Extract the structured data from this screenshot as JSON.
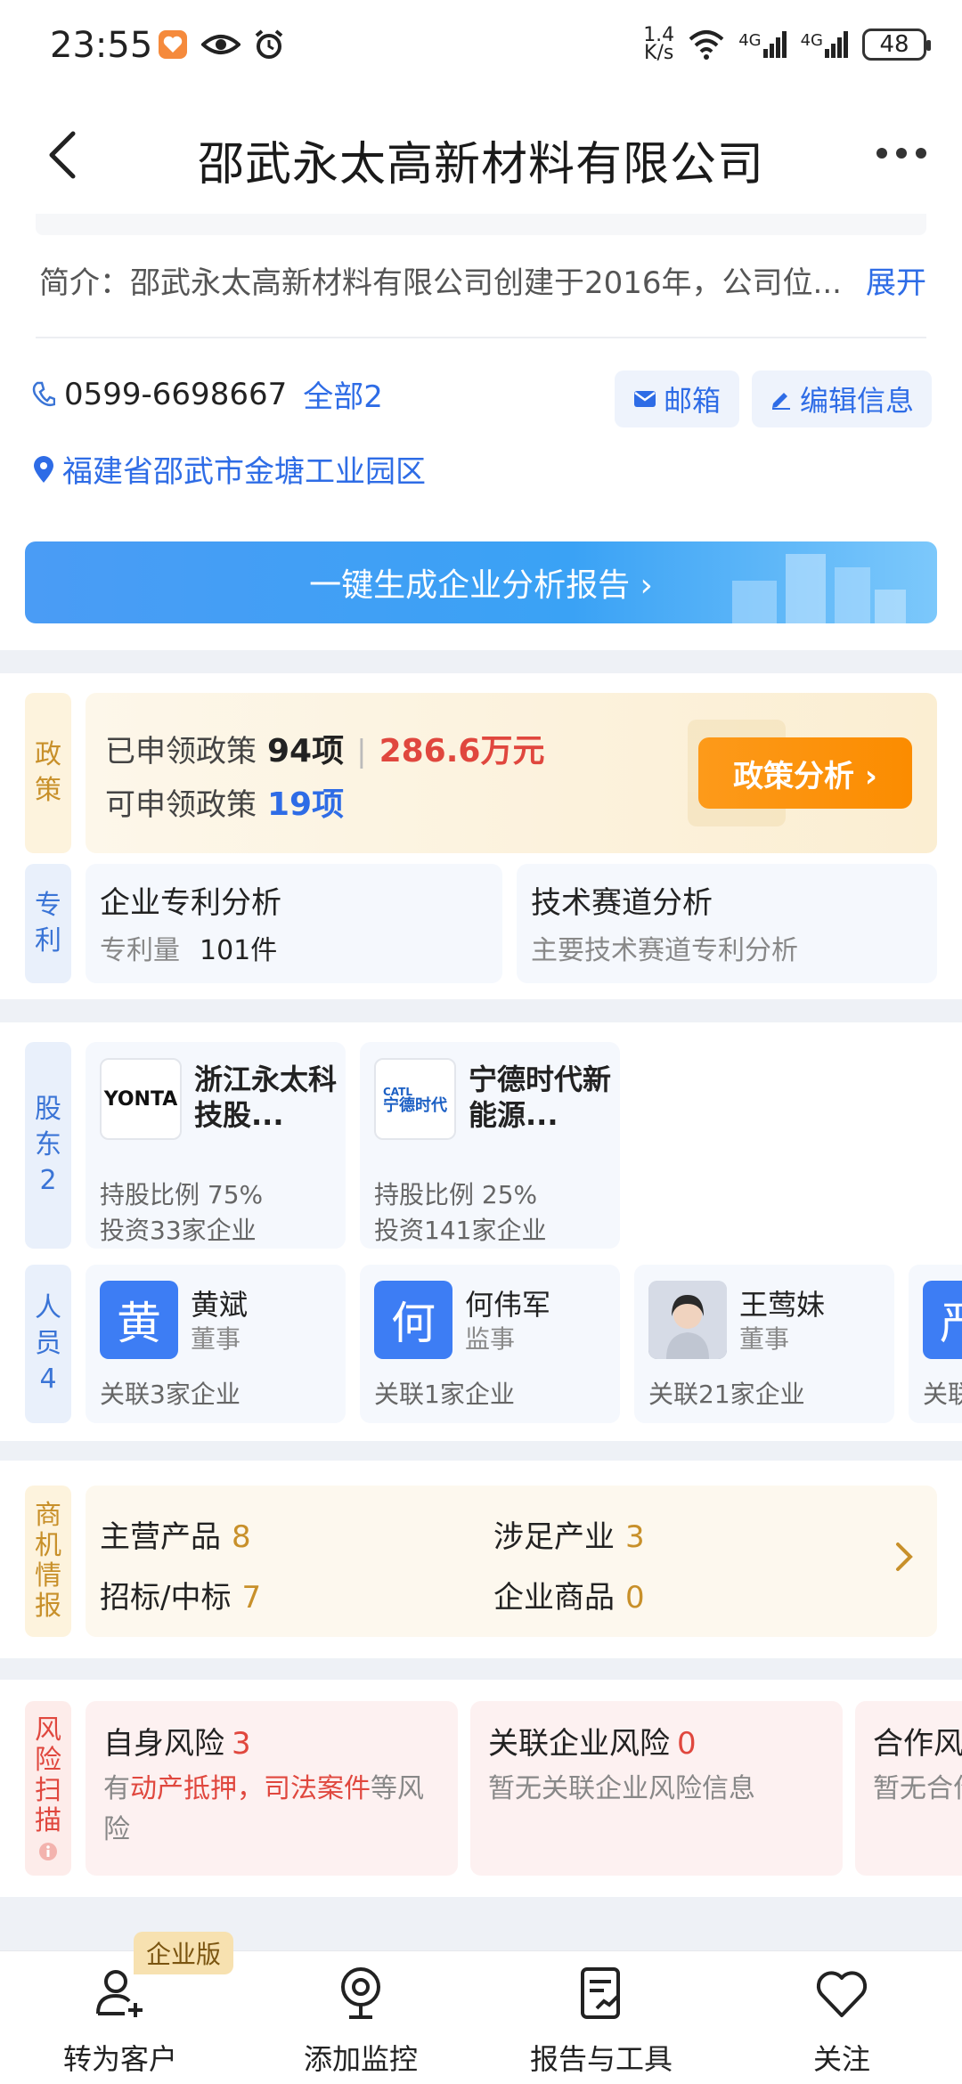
{
  "status": {
    "time": "23:55",
    "net_speed_value": "1.4",
    "net_speed_unit": "K/s",
    "signal1": "4G",
    "signal2": "4G",
    "battery": "48"
  },
  "nav": {
    "title": "邵武永太高新材料有限公司"
  },
  "intro": {
    "label": "简介：",
    "text": "邵武永太高新材料有限公司创建于2016年，公司位...",
    "expand": "展开"
  },
  "contact": {
    "phone": "0599-6698667",
    "all": "全部2",
    "mail": "邮箱",
    "edit": "编辑信息",
    "address": "福建省邵武市金塘工业园区"
  },
  "report_button": "一键生成企业分析报告 ›",
  "policy": {
    "tag": [
      "政",
      "策"
    ],
    "applied_label": "已申领政策",
    "applied_count": "94项",
    "amount": "286.6万元",
    "available_label": "可申领政策",
    "available_count": "19项",
    "button": "政策分析 ›"
  },
  "patent": {
    "tag": [
      "专",
      "利"
    ],
    "left_title": "企业专利分析",
    "left_sub_label": "专利量",
    "left_sub_value": "101件",
    "right_title": "技术赛道分析",
    "right_sub": "主要技术赛道专利分析"
  },
  "shareholders": {
    "tag": [
      "股",
      "东",
      "2"
    ],
    "items": [
      {
        "logo": "YONTA",
        "name": "浙江永太科技股...",
        "ratio": "持股比例 75%",
        "invest": "投资33家企业"
      },
      {
        "logo": "宁德时代",
        "logo_sup": "CATL",
        "name": "宁德时代新能源...",
        "ratio": "持股比例 25%",
        "invest": "投资141家企业"
      }
    ]
  },
  "staff": {
    "tag": [
      "人",
      "员",
      "4"
    ],
    "items": [
      {
        "avatar": "黄",
        "name": "黄斌",
        "role": "董事",
        "rel": "关联3家企业"
      },
      {
        "avatar": "何",
        "name": "何伟军",
        "role": "监事",
        "rel": "关联1家企业"
      },
      {
        "avatar": "",
        "name": "王莺妹",
        "role": "董事",
        "rel": "关联21家企业"
      },
      {
        "avatar": "严",
        "name": "",
        "role": "",
        "rel": "关联"
      }
    ]
  },
  "business": {
    "tag": [
      "商",
      "机",
      "情",
      "报"
    ],
    "items": [
      {
        "label": "主营产品",
        "value": "8"
      },
      {
        "label": "涉足产业",
        "value": "3"
      },
      {
        "label": "招标/中标",
        "value": "7"
      },
      {
        "label": "企业商品",
        "value": "0"
      }
    ]
  },
  "risk": {
    "tag": [
      "风",
      "险",
      "扫",
      "描"
    ],
    "items": [
      {
        "title": "自身风险",
        "count": "3",
        "desc_pre": "有",
        "desc_hl": "动产抵押，司法案件",
        "desc_post": "等风险"
      },
      {
        "title": "关联企业风险",
        "count": "0",
        "desc": "暂无关联企业风险信息"
      },
      {
        "title": "合作风",
        "desc": "暂无合作"
      }
    ]
  },
  "bottom_bar": {
    "badge": "企业版",
    "items": [
      "转为客户",
      "添加监控",
      "报告与工具",
      "关注"
    ]
  },
  "colors": {
    "accent_blue": "#2e6ce6",
    "warn_red": "#e0473e",
    "gold": "#c8902a",
    "orange": "#fb8c00"
  }
}
